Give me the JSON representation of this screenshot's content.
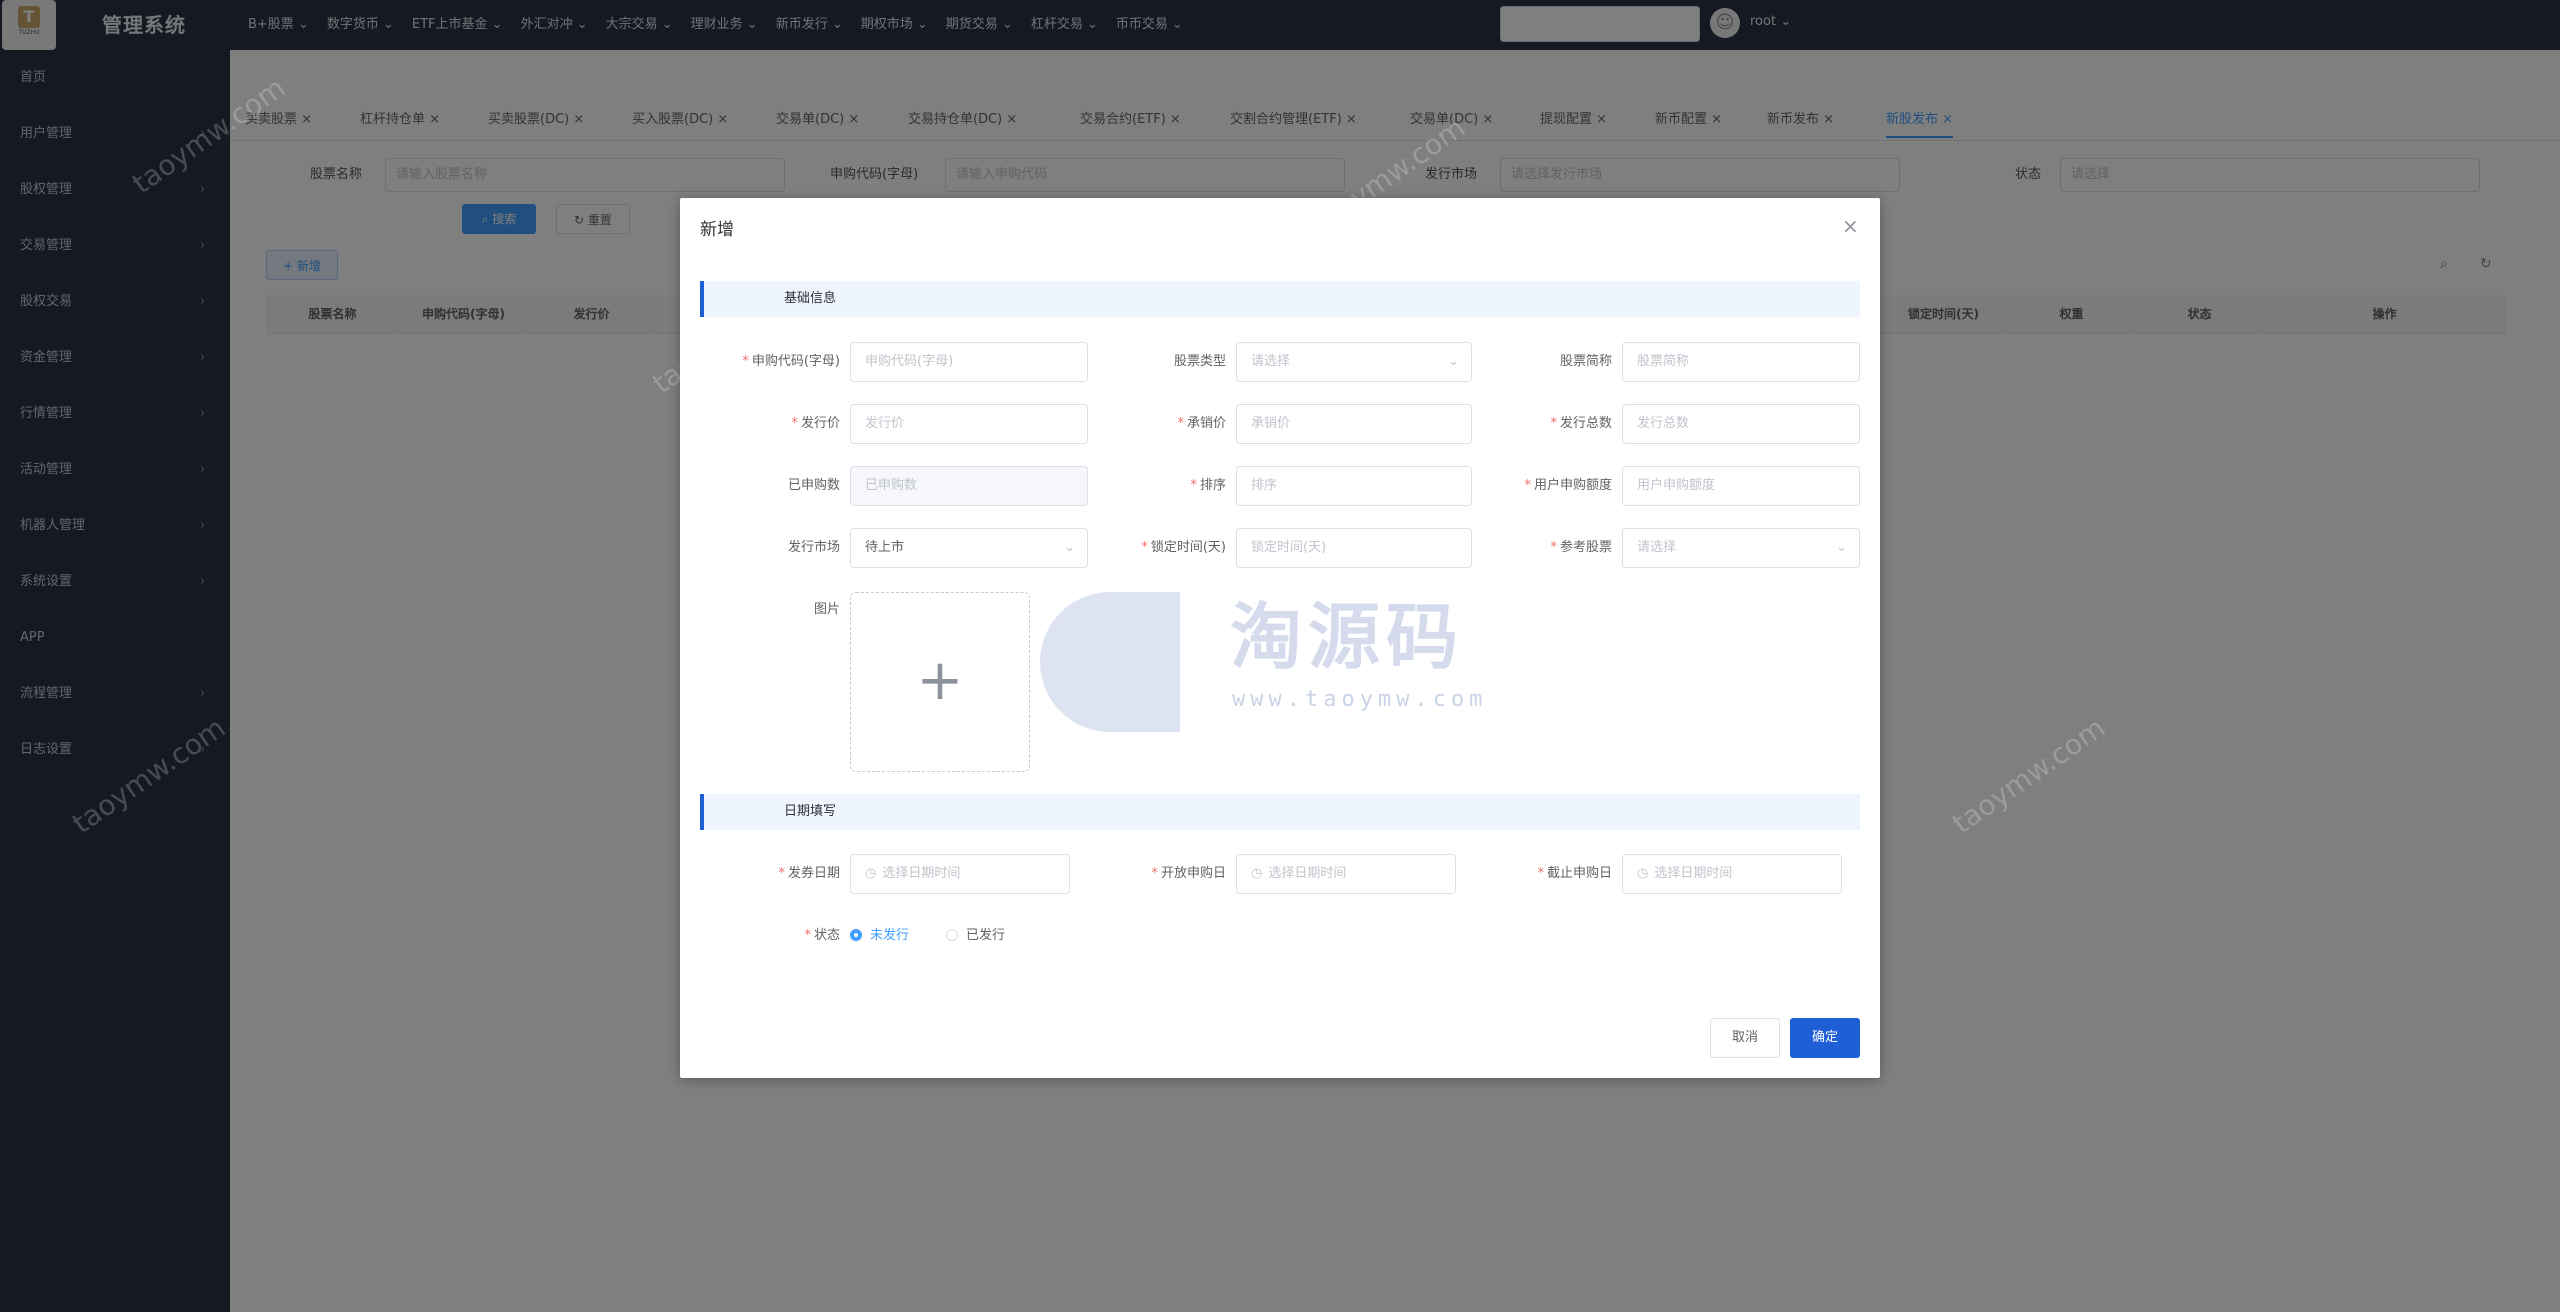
{
  "app": {
    "title": "管理系统",
    "logo_text": "TUZHU"
  },
  "topnav": [
    "B+股票",
    "数字货币",
    "ETF上市基金",
    "外汇对冲",
    "大宗交易",
    "理财业务",
    "新币发行",
    "期权市场",
    "期货交易",
    "杠杆交易",
    "币币交易"
  ],
  "user": {
    "name": "root"
  },
  "sidebar": [
    "首页",
    "用户管理",
    "股权管理",
    "交易管理",
    "股权交易",
    "资金管理",
    "行情管理",
    "活动管理",
    "机器人管理",
    "系统设置",
    "APP",
    "流程管理",
    "日志设置"
  ],
  "tabs": [
    "买卖股票",
    "杠杆持仓单",
    "买卖股票(DC)",
    "买入股票(DC)",
    "交易单(DC)",
    "交易持仓单(DC)",
    "交易合约(ETF)",
    "交割合约管理(ETF)",
    "交易单(DC)",
    "提现配置",
    "新币配置",
    "新币发布",
    "新股发布"
  ],
  "background_page": {
    "filters": [
      {
        "label": "股票名称",
        "placeholder": "请输入股票名称"
      },
      {
        "label": "申购代码(字母)",
        "placeholder": "请输入申购代码"
      },
      {
        "label": "发行市场",
        "placeholder": "请选择发行市场"
      },
      {
        "label": "状态",
        "placeholder": "请选择"
      }
    ],
    "search_label": "搜索",
    "reset_label": "重置",
    "add_label": "+ 新增",
    "columns": [
      "股票名称",
      "申购代码(字母)",
      "发行价",
      "锁定时间(天)",
      "权重",
      "状态",
      "操作"
    ]
  },
  "dialog": {
    "title": "新增",
    "section_basic": "基础信息",
    "section_dates": "日期填写",
    "fields": {
      "code": {
        "label": "申购代码(字母)",
        "placeholder": "申购代码(字母)"
      },
      "stock_type": {
        "label": "股票类型",
        "placeholder": "请选择"
      },
      "short_name": {
        "label": "股票简称",
        "placeholder": "股票简称"
      },
      "issue_price": {
        "label": "发行价",
        "placeholder": "发行价"
      },
      "underwrite_price": {
        "label": "承销价",
        "placeholder": "承销价"
      },
      "total_issue": {
        "label": "发行总数",
        "placeholder": "发行总数"
      },
      "subscribed": {
        "label": "已申购数",
        "placeholder": "已申购数"
      },
      "sort": {
        "label": "排序",
        "placeholder": "排序"
      },
      "user_quota": {
        "label": "用户申购额度",
        "placeholder": "用户申购额度"
      },
      "market": {
        "label": "发行市场",
        "value": "待上市"
      },
      "lock_days": {
        "label": "锁定时间(天)",
        "placeholder": "锁定时间(天)"
      },
      "ref_stock": {
        "label": "参考股票",
        "placeholder": "请选择"
      },
      "image": {
        "label": "图片"
      },
      "issue_date": {
        "label": "发券日期",
        "placeholder": "选择日期时间"
      },
      "open_date": {
        "label": "开放申购日",
        "placeholder": "选择日期时间"
      },
      "close_date": {
        "label": "截止申购日",
        "placeholder": "选择日期时间"
      },
      "status": {
        "label": "状态",
        "options": [
          "未发行",
          "已发行"
        ],
        "selected": "未发行"
      }
    },
    "cancel_label": "取消",
    "confirm_label": "确定"
  },
  "watermark": {
    "text": "taoymw.com",
    "logo_cn": "淘源码",
    "logo_url": "www.taoymw.com"
  },
  "colors": {
    "primary": "#1f5fd6",
    "accent": "#409eff",
    "required": "#f56c6c",
    "sidebar": "#2b3342"
  }
}
